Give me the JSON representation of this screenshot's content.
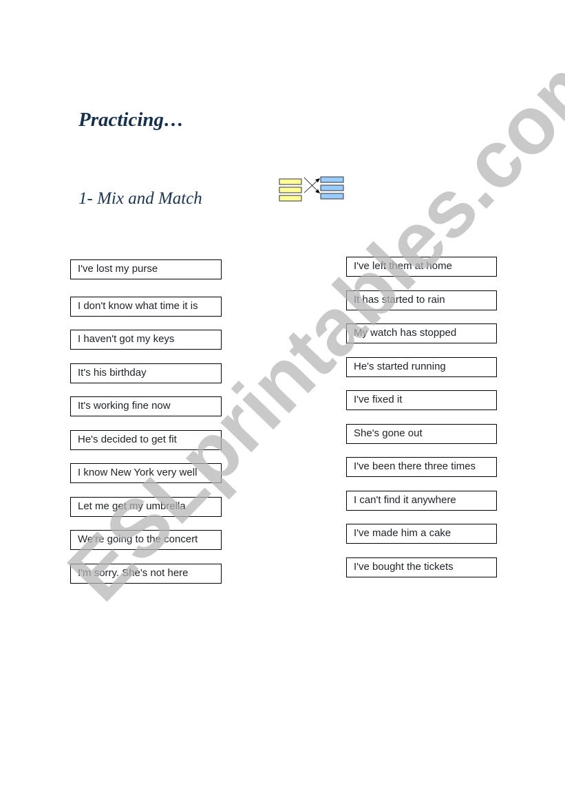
{
  "document": {
    "title": "Practicing…",
    "section_heading": "1- Mix and Match",
    "icon": "mix-and-match-icon",
    "watermark": "ESLprintables.com",
    "colors": {
      "title": "#14304e",
      "icon_left_fill": "#ffff99",
      "icon_right_fill": "#99ccff",
      "watermark": "#c8c8c8"
    }
  },
  "left_column": [
    {
      "text": "I've lost my purse"
    },
    {
      "text": "I don't know what time it is"
    },
    {
      "text": "I haven't got my keys"
    },
    {
      "text": "It's his birthday"
    },
    {
      "text": "It's working fine now"
    },
    {
      "text": "He's decided to get fit"
    },
    {
      "text": "I know New York very well"
    },
    {
      "text": "Let me get my umbrella"
    },
    {
      "text": "We're going to the concert"
    },
    {
      "text": "I'm sorry. She's not here"
    }
  ],
  "right_column": [
    {
      "text": "I've left them at home"
    },
    {
      "text": "It has started to rain"
    },
    {
      "text": "My watch has stopped"
    },
    {
      "text": "He's started running"
    },
    {
      "text": "I've fixed it"
    },
    {
      "text": "She's gone out"
    },
    {
      "text": "I've been there three times"
    },
    {
      "text": "I can't find it anywhere"
    },
    {
      "text": "I've made him a cake"
    },
    {
      "text": "I've bought the tickets"
    }
  ]
}
